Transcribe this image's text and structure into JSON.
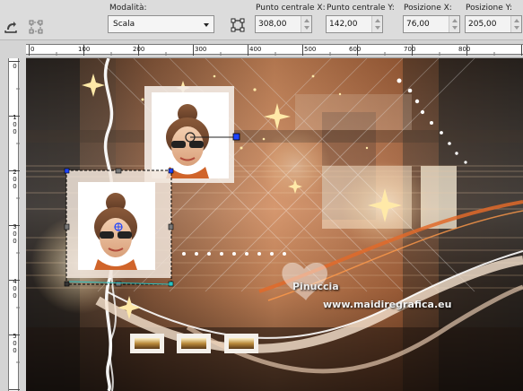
{
  "toolbar": {
    "mode_label": "Modalità:",
    "mode_value": "Scala",
    "center_x_label": "Punto centrale X:",
    "center_x_value": "308,00",
    "center_y_label": "Punto centrale Y:",
    "center_y_value": "142,00",
    "pos_x_label": "Posizione X:",
    "pos_x_value": "76,00",
    "pos_y_label": "Posizione Y:",
    "pos_y_value": "205,00",
    "icons": [
      "pick-tool-icon",
      "transform-icon",
      "center-rotation-icon"
    ]
  },
  "ruler_horizontal": [
    "0",
    "100",
    "200",
    "300",
    "400",
    "500",
    "600",
    "700",
    "800"
  ],
  "ruler_vertical": [
    [
      "0"
    ],
    [
      "1",
      "0",
      "0"
    ],
    [
      "2",
      "0",
      "0"
    ],
    [
      "3",
      "0",
      "0"
    ],
    [
      "4",
      "0",
      "0"
    ],
    [
      "5",
      "0",
      "0"
    ]
  ],
  "canvas": {
    "watermark_name": "Pinuccia",
    "watermark_site": "www.maidiregrafica.eu",
    "thumbnail_count": 3,
    "colors": {
      "dark_brown": "#3b2a20",
      "copper": "#c9784a",
      "cream": "#f4e4cf",
      "selection": "#1e44ff"
    }
  }
}
